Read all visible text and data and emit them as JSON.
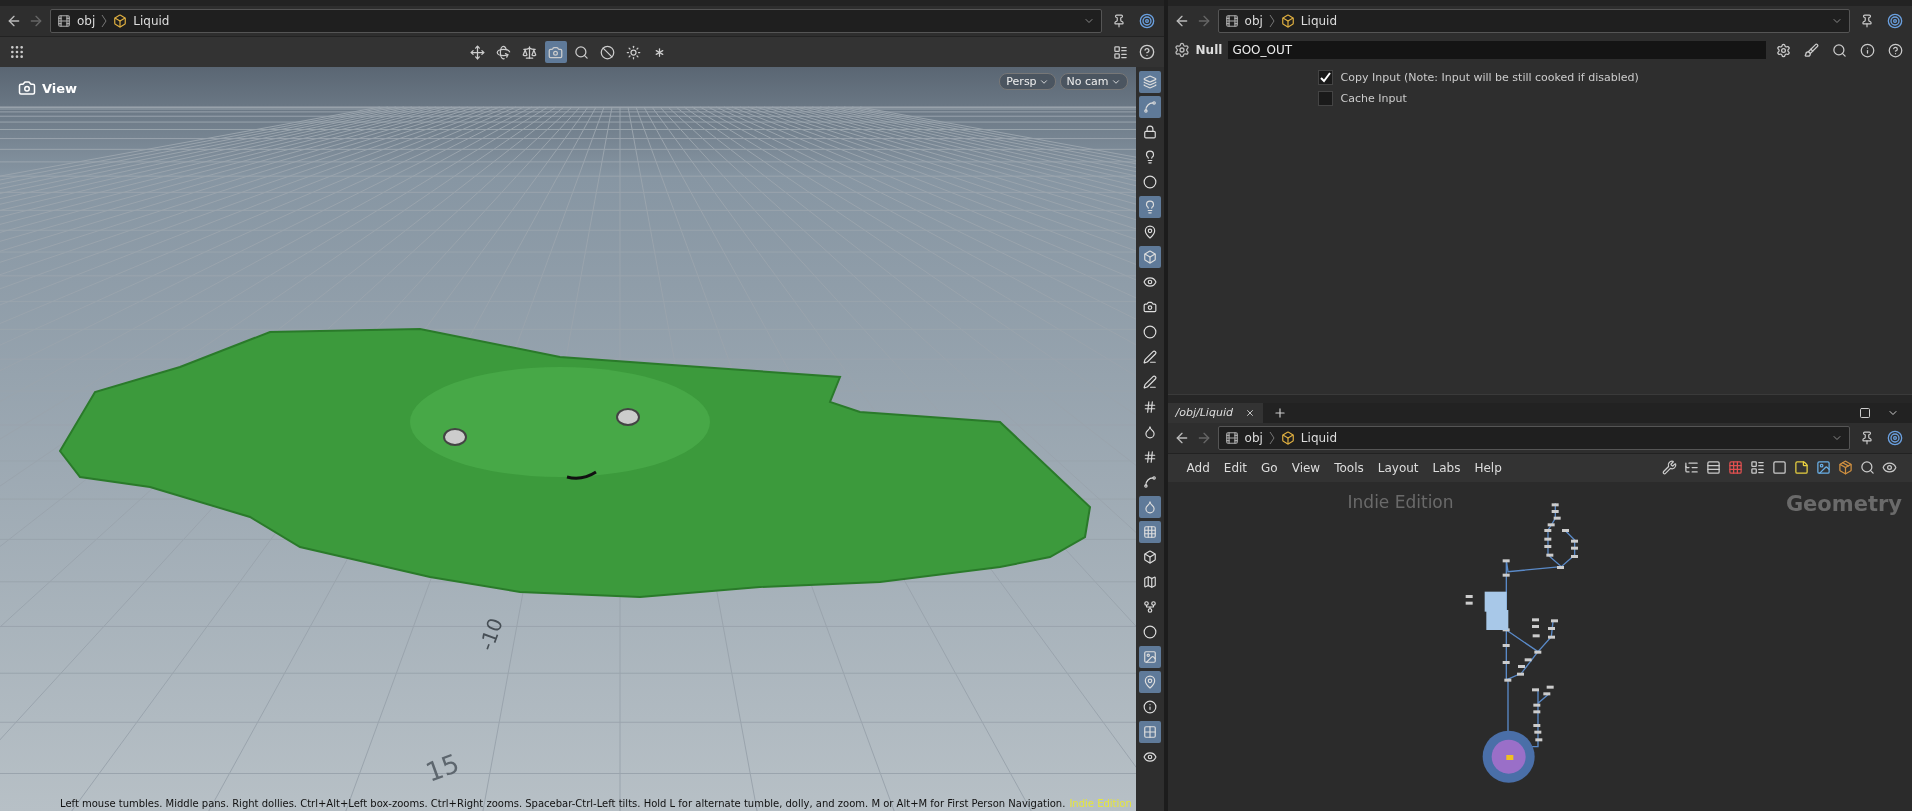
{
  "viewer": {
    "path": {
      "crumbs": [
        "obj",
        "Liquid"
      ]
    },
    "tools": [
      {
        "active": false
      },
      {
        "active": false
      },
      {
        "active": false
      },
      {
        "active": true
      },
      {
        "active": false
      },
      {
        "active": false
      },
      {
        "active": false
      },
      {
        "active": false
      }
    ],
    "label": "View",
    "camera_menus": [
      "Persp",
      "No cam"
    ],
    "grid_labels": [
      "-10",
      "15"
    ],
    "side_tools": [
      {
        "active": true
      },
      {
        "active": true
      },
      {
        "active": false
      },
      {
        "active": false
      },
      {
        "active": false
      },
      {
        "active": true
      },
      {
        "active": false
      },
      {
        "active": true
      },
      {
        "active": false
      },
      {
        "active": false
      },
      {
        "active": false
      },
      {
        "active": false
      },
      {
        "active": false
      },
      {
        "active": false
      },
      {
        "active": false
      },
      {
        "active": false
      },
      {
        "active": false
      },
      {
        "active": true
      },
      {
        "active": true
      },
      {
        "active": false
      },
      {
        "active": false
      },
      {
        "active": false
      },
      {
        "active": false
      },
      {
        "active": true
      },
      {
        "active": true
      },
      {
        "active": false
      },
      {
        "active": true
      },
      {
        "active": false
      }
    ],
    "status": "Left mouse tumbles. Middle pans. Right dollies. Ctrl+Alt+Left box-zooms. Ctrl+Right zooms. Spacebar-Ctrl-Left tilts. Hold L for alternate tumble, dolly, and zoom. M or Alt+M for First Person Navigation.",
    "edition": "Indie Edition"
  },
  "parameters": {
    "path": {
      "crumbs": [
        "obj",
        "Liquid"
      ]
    },
    "node_type": "Null",
    "node_name": "GOO_OUT",
    "toggles": [
      {
        "label": "Copy Input (Note: Input will be still cooked if disabled)",
        "checked": true
      },
      {
        "label": "Cache Input",
        "checked": false
      }
    ]
  },
  "network": {
    "tabs": [
      {
        "label": "/obj/Liquid",
        "selected": true
      }
    ],
    "path": {
      "crumbs": [
        "obj",
        "Liquid"
      ]
    },
    "menu": [
      "Add",
      "Edit",
      "Go",
      "View",
      "Tools",
      "Layout",
      "Labs",
      "Help"
    ],
    "watermark": "Indie Edition",
    "context": "Geometry"
  }
}
